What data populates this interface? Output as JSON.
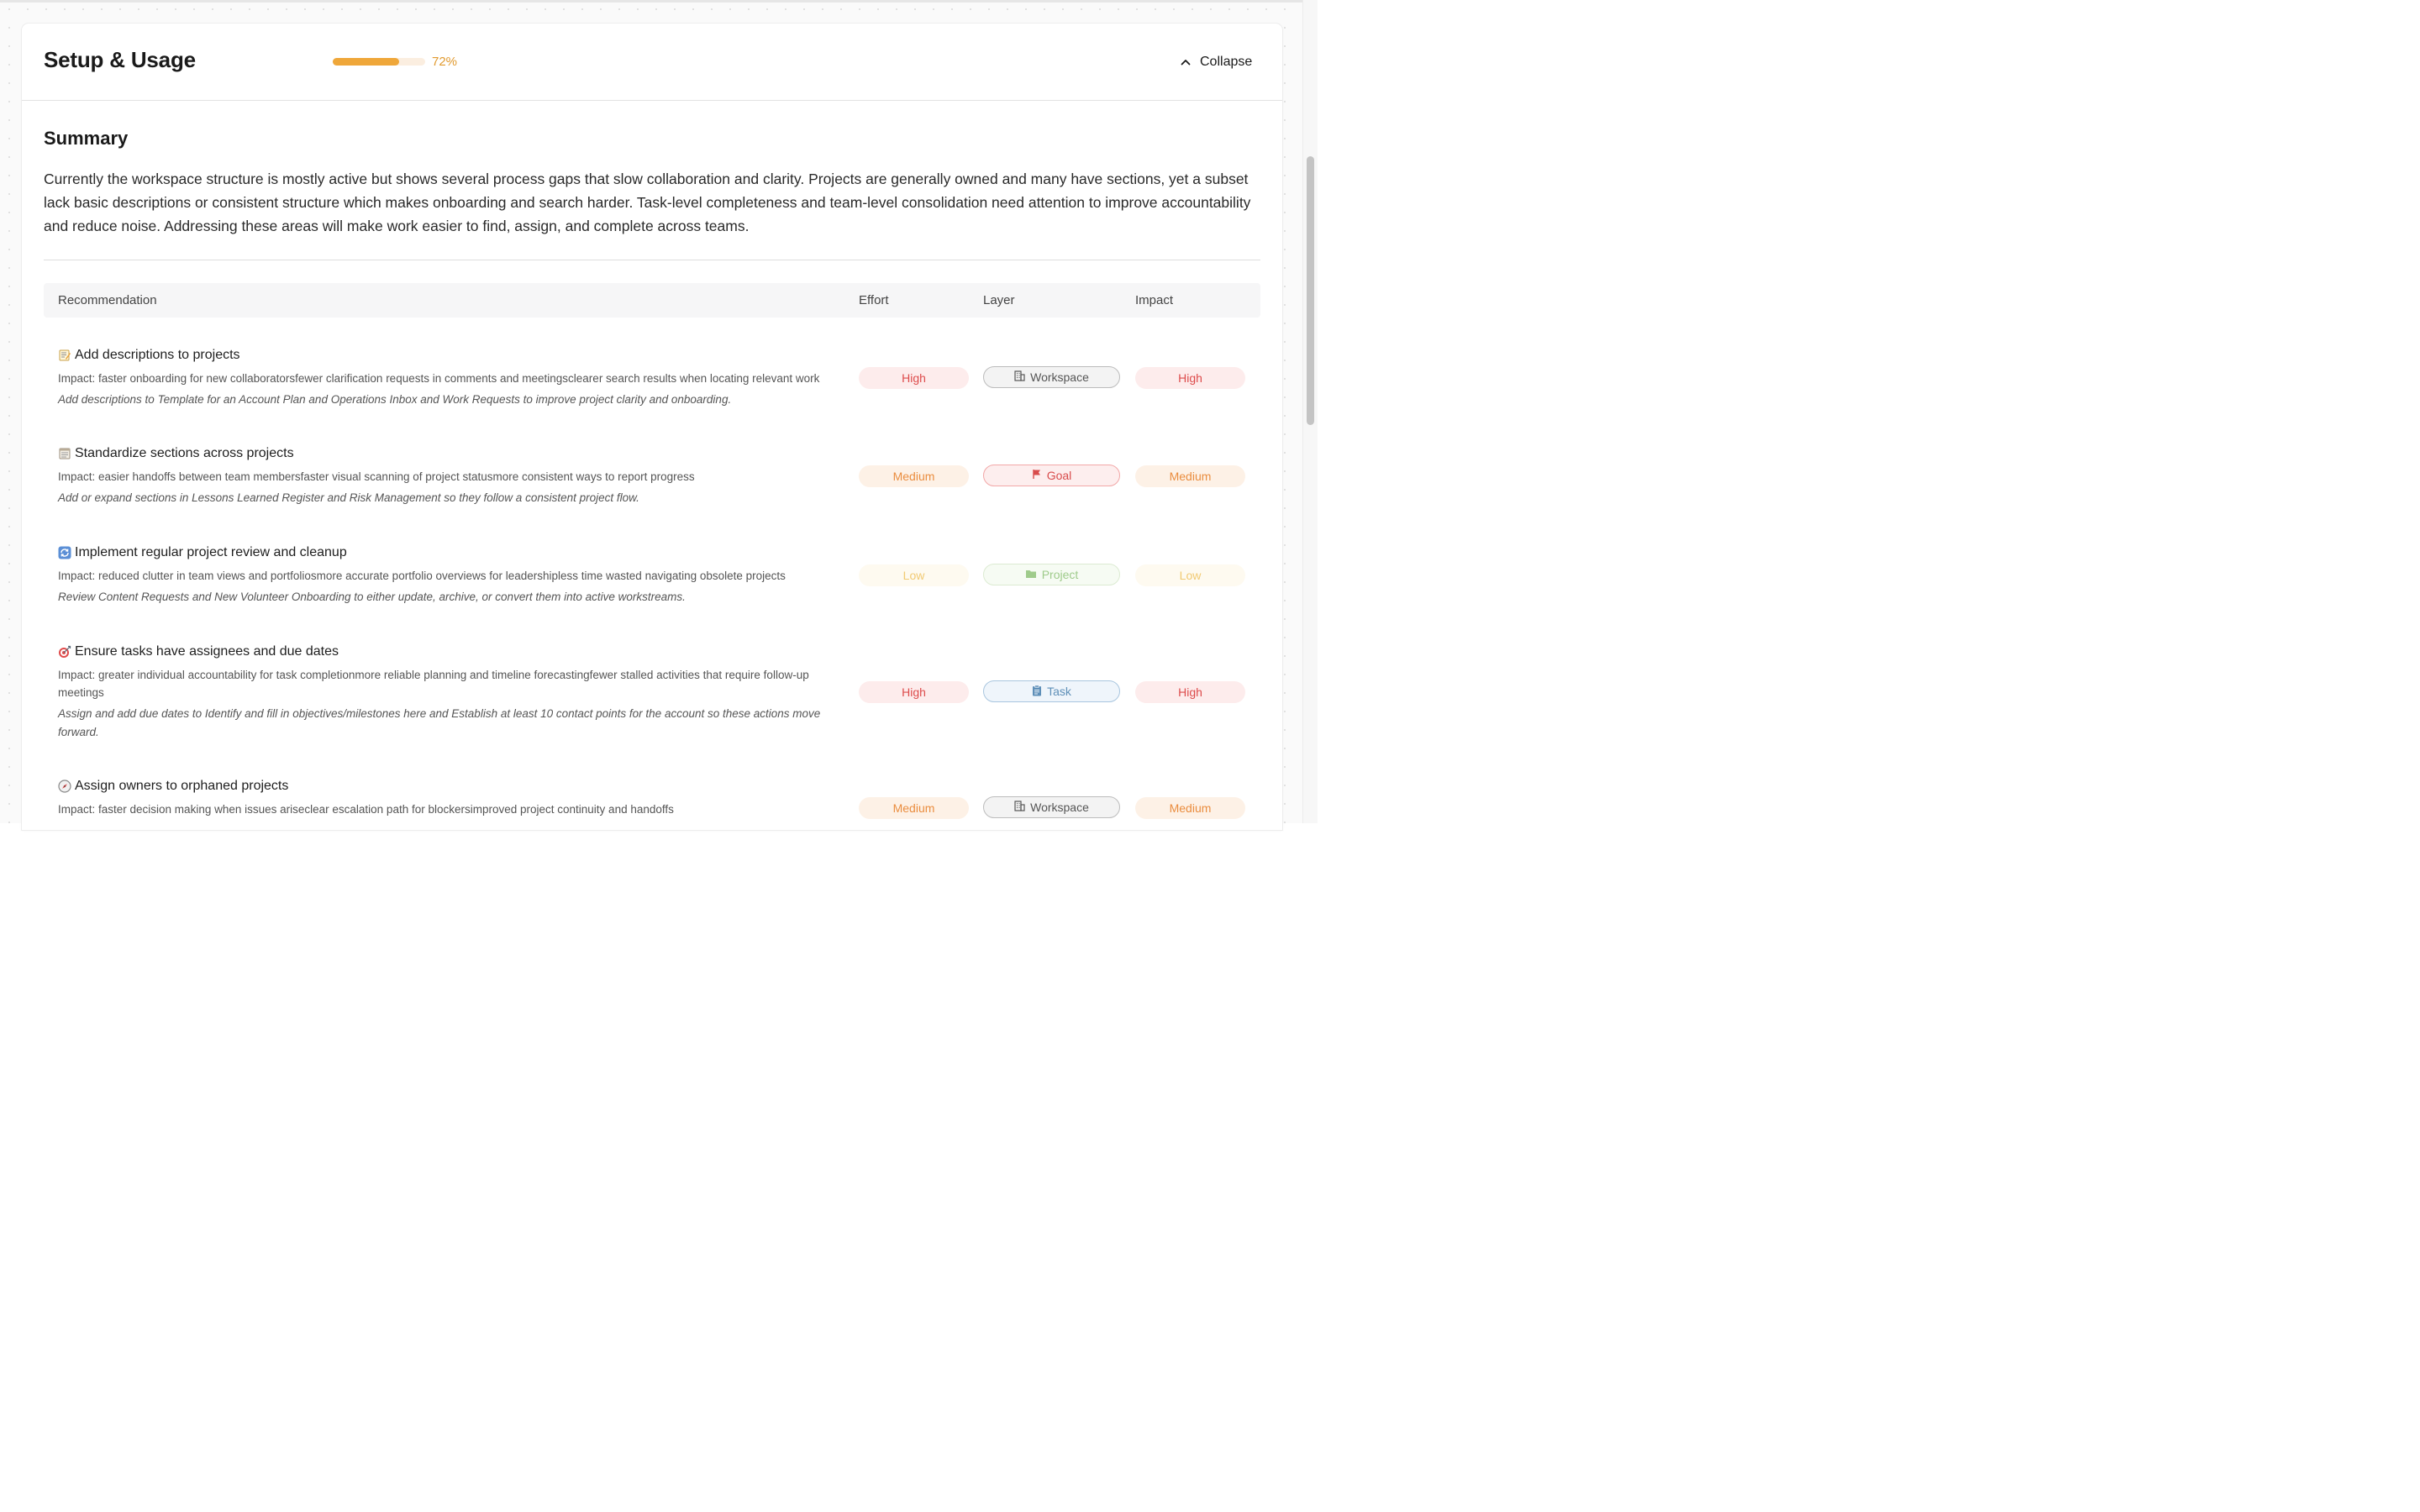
{
  "header": {
    "title": "Setup & Usage",
    "progress_percent": 72,
    "progress_label": "72%",
    "collapse_label": "Collapse",
    "accent": "#efa73a"
  },
  "summary": {
    "title": "Summary",
    "text": "Currently the workspace structure is mostly active but shows several process gaps that slow collaboration and clarity. Projects are generally owned and many have sections, yet a subset lack basic descriptions or consistent structure which makes onboarding and search harder. Task-level completeness and team-level consolidation need attention to improve accountability and reduce noise. Addressing these areas will make work easier to find, assign, and complete across teams."
  },
  "table": {
    "headers": {
      "recommendation": "Recommendation",
      "effort": "Effort",
      "layer": "Layer",
      "impact": "Impact"
    },
    "rows": [
      {
        "icon": "memo-icon",
        "title": "Add descriptions to projects",
        "impact_text": "Impact: faster onboarding for new collaboratorsfewer clarification requests in comments and meetingsclearer search results when locating relevant work",
        "action_text": "Add descriptions to Template for an Account Plan and Operations Inbox and Work Requests to improve project clarity and onboarding.",
        "effort": "High",
        "layer": "Workspace",
        "layer_icon": "building-icon",
        "impact": "High"
      },
      {
        "icon": "notepad-icon",
        "title": "Standardize sections across projects",
        "impact_text": "Impact: easier handoffs between team membersfaster visual scanning of project statusmore consistent ways to report progress",
        "action_text": "Add or expand sections in Lessons Learned Register and Risk Management so they follow a consistent project flow.",
        "effort": "Medium",
        "layer": "Goal",
        "layer_icon": "flag-icon",
        "impact": "Medium"
      },
      {
        "icon": "refresh-icon",
        "title": "Implement regular project review and cleanup",
        "impact_text": "Impact: reduced clutter in team views and portfoliosmore accurate portfolio overviews for leadershipless time wasted navigating obsolete projects",
        "action_text": "Review Content Requests and New Volunteer Onboarding to either update, archive, or convert them into active workstreams.",
        "effort": "Low",
        "layer": "Project",
        "layer_icon": "folder-icon",
        "impact": "Low"
      },
      {
        "icon": "target-icon",
        "title": "Ensure tasks have assignees and due dates",
        "impact_text": "Impact: greater individual accountability for task completionmore reliable planning and timeline forecastingfewer stalled activities that require follow-up meetings",
        "action_text": "Assign and add due dates to Identify and fill in objectives/milestones here and Establish at least 10 contact points for the account so these actions move forward.",
        "effort": "High",
        "layer": "Task",
        "layer_icon": "clipboard-icon",
        "impact": "High"
      },
      {
        "icon": "compass-icon",
        "title": "Assign owners to orphaned projects",
        "impact_text": "Impact: faster decision making when issues ariseclear escalation path for blockersimproved project continuity and handoffs",
        "action_text": "",
        "effort": "Medium",
        "layer": "Workspace",
        "layer_icon": "building-icon",
        "impact": "Medium"
      }
    ]
  }
}
